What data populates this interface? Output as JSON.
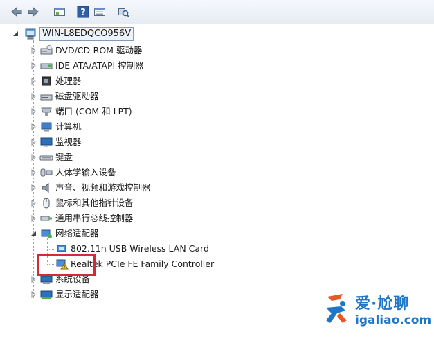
{
  "toolbar": {
    "buttons": [
      "back-arrow-icon",
      "forward-arrow-icon",
      "properties-icon",
      "help-icon",
      "view-icon",
      "scan-hardware-icon"
    ]
  },
  "tree": {
    "root": {
      "label": "WIN-L8EDQCO956V"
    },
    "items": [
      {
        "label": "DVD/CD-ROM 驱动器",
        "icon": "dvd-drive-icon"
      },
      {
        "label": "IDE ATA/ATAPI 控制器",
        "icon": "ide-controller-icon"
      },
      {
        "label": "处理器",
        "icon": "processor-icon"
      },
      {
        "label": "磁盘驱动器",
        "icon": "disk-drive-icon"
      },
      {
        "label": "端口 (COM 和 LPT)",
        "icon": "port-icon"
      },
      {
        "label": "计算机",
        "icon": "computer-icon"
      },
      {
        "label": "监视器",
        "icon": "monitor-icon"
      },
      {
        "label": "键盘",
        "icon": "keyboard-icon"
      },
      {
        "label": "人体学输入设备",
        "icon": "hid-icon"
      },
      {
        "label": "声音、视频和游戏控制器",
        "icon": "speaker-icon"
      },
      {
        "label": "鼠标和其他指针设备",
        "icon": "mouse-icon"
      },
      {
        "label": "通用串行总线控制器",
        "icon": "usb-icon"
      },
      {
        "label": "网络适配器",
        "icon": "network-adapter-icon",
        "children": [
          {
            "label": "802.11n USB Wireless LAN Card",
            "icon": "network-card-icon"
          },
          {
            "label": "Realtek PCIe FE Family Controller",
            "icon": "network-card-warning-icon"
          }
        ]
      },
      {
        "label": "系统设备",
        "icon": "system-device-icon"
      },
      {
        "label": "显示适配器",
        "icon": "display-adapter-icon"
      }
    ]
  },
  "watermark": {
    "cn": "爱·尬聊",
    "en": "igaliao.com"
  },
  "colors": {
    "highlight": "#d12b3a",
    "brand": "#1f75c7",
    "toolbar": "#e6ecf4"
  }
}
